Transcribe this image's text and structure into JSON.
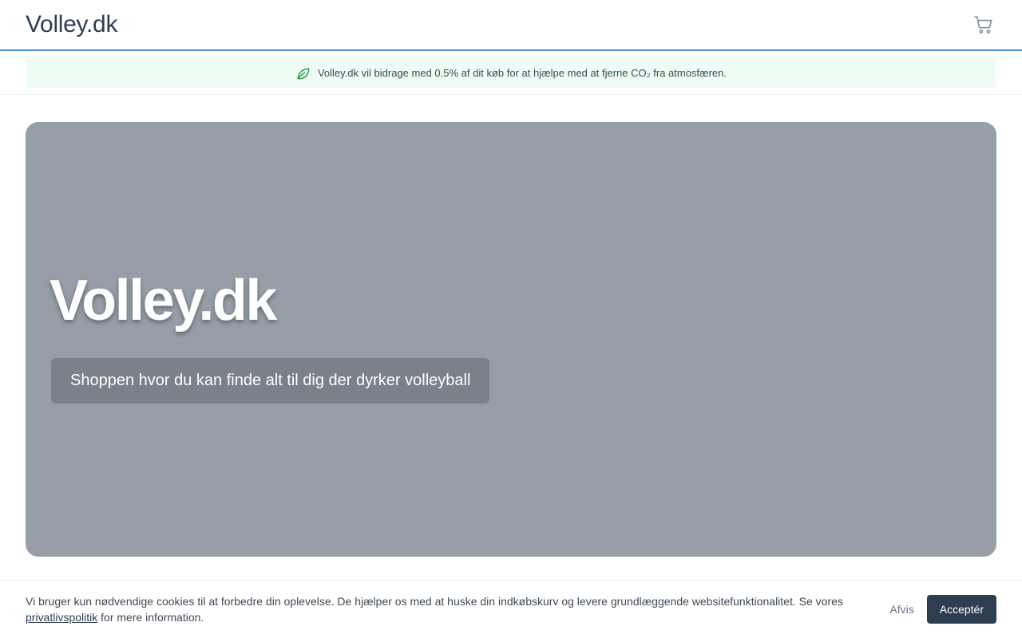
{
  "header": {
    "logo": "Volley.dk",
    "cart_icon": "shopping-cart-icon"
  },
  "notice": {
    "icon": "leaf-icon",
    "text": "Volley.dk vil bidrage med 0.5% af dit køb for at hjælpe med at fjerne CO₂ fra atmosfæren."
  },
  "hero": {
    "title": "Volley.dk",
    "subtitle": "Shoppen hvor du kan finde alt til dig der dyrker volleyball"
  },
  "cookie": {
    "text_before": "Vi bruger kun nødvendige cookies til at forbedre din oplevelse. De hjælper os med at huske din indkøbskurv og levere grundlæggende websitefunktionalitet. Se vores ",
    "link": "privatlivspolitik",
    "text_after": " for mere information.",
    "decline": "Afvis",
    "accept": "Acceptér"
  },
  "colors": {
    "accent": "#4a90c8",
    "primary": "#2d3e50",
    "notice_bg": "#effcf3",
    "leaf": "#2f9e57",
    "hero_bg": "#979ea8"
  }
}
